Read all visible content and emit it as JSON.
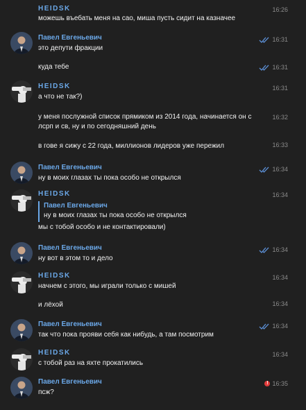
{
  "users": {
    "heidsk": "HEIDSK",
    "pavel": "Павел Евгеньевич"
  },
  "icons": {
    "read_ticks": "double-check-icon",
    "send_error": "error-icon",
    "error_glyph": "!"
  },
  "colors": {
    "background": "#202020",
    "sender_name": "#6ba8e8",
    "read_ticks": "#5b8ed4",
    "error": "#e23b3b"
  },
  "messages": [
    {
      "text": "можешь въебать меня на сао, миша пусть сидит на казначее",
      "time": "16:26",
      "ticks": false,
      "error": false
    },
    {
      "text": "это депути фракции",
      "time": "16:31",
      "ticks": true,
      "error": false
    },
    {
      "text": "куда тебе",
      "time": "16:31",
      "ticks": true,
      "error": false
    },
    {
      "text": "а что не так?)",
      "time": "16:31",
      "ticks": false,
      "error": false
    },
    {
      "text": "у меня послужной список прямиком из 2014 года, начинается он с",
      "text2": "лсрп и св, ну и по сегодняшний день",
      "time": "16:32",
      "ticks": false,
      "error": false
    },
    {
      "text": "в гове я сижу с 22 года, миллионов лидеров уже пережил",
      "time": "16:33",
      "ticks": false,
      "error": false
    },
    {
      "text": "ну в моих глазах ты пока особо не открылся",
      "time": "16:34",
      "ticks": true,
      "error": false
    },
    {
      "quote_name": "Павел Евгеньевич",
      "quote_text": "ну в моих глазах ты пока особо не открылся",
      "text": "мы с тобой особо и не контактировали)",
      "time": "16:34",
      "ticks": false,
      "error": false
    },
    {
      "text": "ну вот в этом то и дело",
      "time": "16:34",
      "ticks": true,
      "error": false
    },
    {
      "text": "начнем с этого, мы играли только с мишей",
      "time": "16:34",
      "ticks": false,
      "error": false
    },
    {
      "text": "и лёхой",
      "time": "16:34",
      "ticks": false,
      "error": false
    },
    {
      "text": "так что пока прояви себя как нибудь, а там посмотрим",
      "time": "16:34",
      "ticks": true,
      "error": false
    },
    {
      "text": "с тобой раз на яхте прокатились",
      "time": "16:34",
      "ticks": false,
      "error": false
    },
    {
      "text": "псж?",
      "time": "16:35",
      "ticks": false,
      "error": true
    }
  ]
}
